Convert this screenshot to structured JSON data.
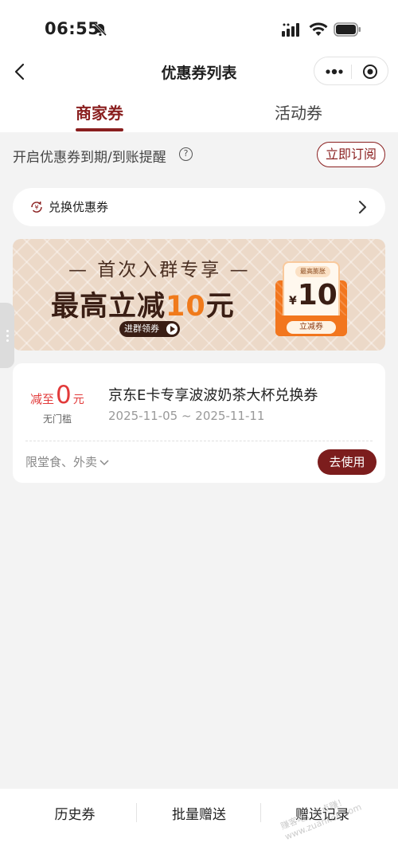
{
  "status_bar": {
    "time": "06:55"
  },
  "nav": {
    "title": "优惠券列表"
  },
  "tabs": [
    {
      "label": "商家券",
      "active": true
    },
    {
      "label": "活动券",
      "active": false
    }
  ],
  "reminder": {
    "text": "开启优惠券到期/到账提醒",
    "button": "立即订阅"
  },
  "exchange": {
    "label": "兑换优惠券"
  },
  "banner": {
    "line1": "— 首次入群专享 —",
    "line2_prefix": "最高立减",
    "line2_number": "10",
    "line2_suffix": "元",
    "button": "进群领券",
    "card_tag": "最高膨胀",
    "card_currency": "¥",
    "card_value": "10",
    "card_button": "立减券"
  },
  "coupon": {
    "prefix": "减至",
    "value": "0",
    "unit": "元",
    "threshold": "无门槛",
    "title": "京东E卡专享波波奶茶大杯兑换券",
    "date": "2025-11-05 ~ 2025-11-11",
    "scope": "限堂食、外卖",
    "use_button": "去使用"
  },
  "bottom_bar": [
    {
      "label": "历史券"
    },
    {
      "label": "批量赠送"
    },
    {
      "label": "赠送记录"
    }
  ],
  "watermark": {
    "line1": "赚客吧，有点赚！",
    "line2": "www.zuanke8.com"
  },
  "colors": {
    "primary": "#8a1f1f",
    "price": "#e23a3a",
    "banner_accent": "#f07a1b"
  },
  "icons": [
    "bell-slash-icon",
    "signal-icon",
    "wifi-icon",
    "battery-icon",
    "back-arrow-icon",
    "more-icon",
    "target-icon",
    "question-icon",
    "exchange-icon",
    "chevron-right-icon",
    "chevron-down-icon"
  ]
}
